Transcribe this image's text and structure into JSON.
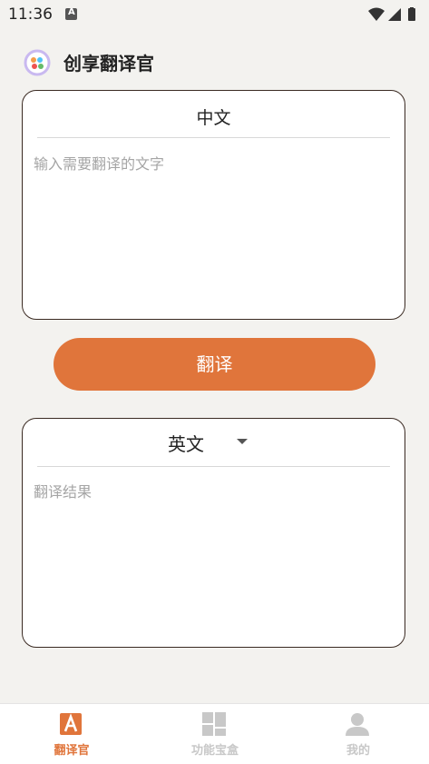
{
  "status_bar": {
    "time": "11:36",
    "notification_badge": "A"
  },
  "header": {
    "title": "创享翻译官",
    "logo_icon": "app-logo-icon"
  },
  "source_panel": {
    "language": "中文",
    "placeholder": "输入需要翻译的文字"
  },
  "translate_button": {
    "label": "翻译"
  },
  "target_panel": {
    "language": "英文",
    "result_placeholder": "翻译结果"
  },
  "tab_bar": {
    "tabs": [
      {
        "label": "翻译官",
        "icon": "translate-icon",
        "active": true
      },
      {
        "label": "功能宝盒",
        "icon": "grid-icon",
        "active": false
      },
      {
        "label": "我的",
        "icon": "user-icon",
        "active": false
      }
    ]
  },
  "colors": {
    "accent": "#e0753b",
    "background": "#f3f2ef",
    "card_border": "#3a2a22",
    "inactive": "#c8c8c8"
  }
}
